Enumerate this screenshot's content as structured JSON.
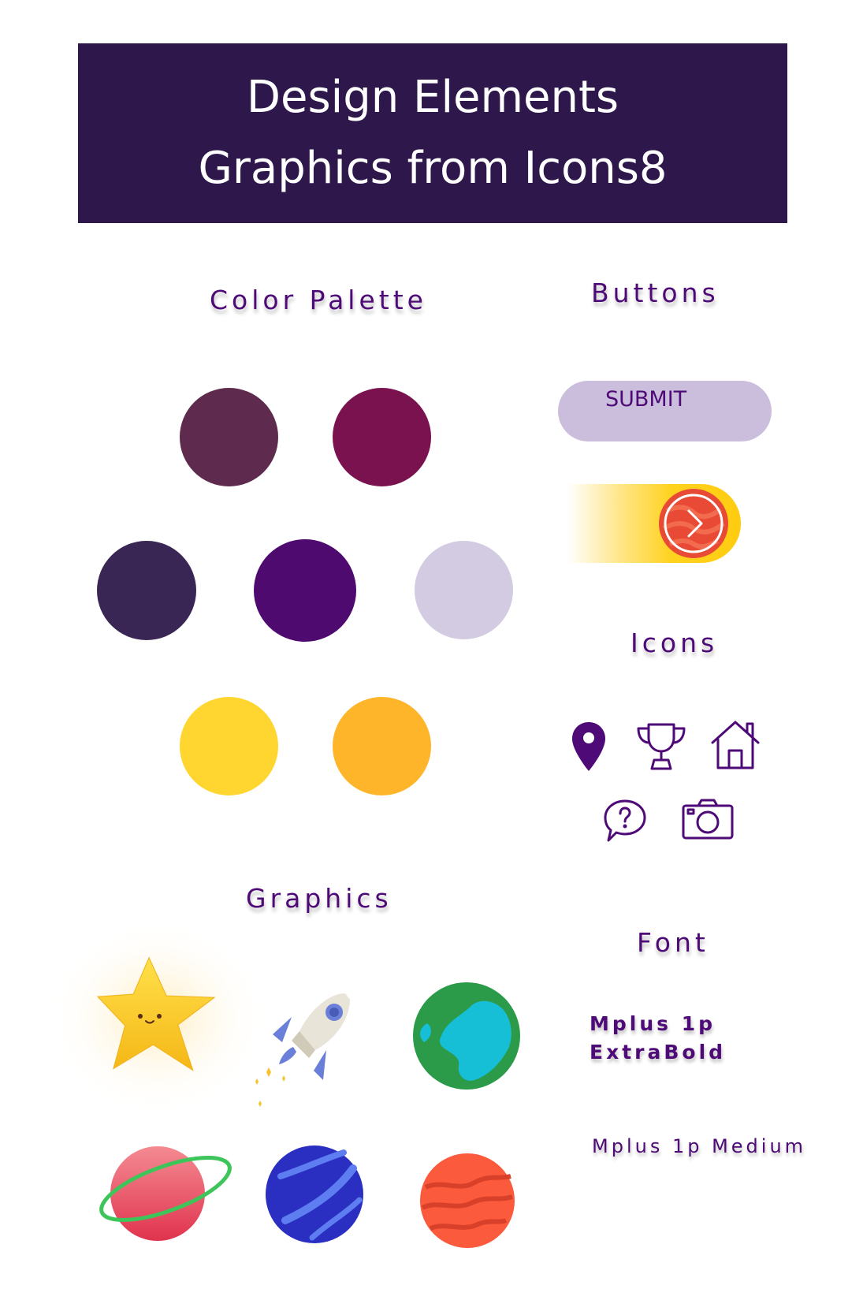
{
  "header": {
    "line1": "Design Elements",
    "line2": "Graphics from Icons8",
    "background": "#2d174b"
  },
  "sections": {
    "color_palette": "Color Palette",
    "buttons": "Buttons",
    "icons": "Icons",
    "graphics": "Graphics",
    "font": "Font"
  },
  "palette": [
    "#5e2a4e",
    "#7b1250",
    "#3a2654",
    "#4e0a6f",
    "#d2cbe2",
    "#ffd630",
    "#ffb52a"
  ],
  "buttons": {
    "submit_label": "SUBMIT",
    "submit_color": "#cbbddc",
    "slider_icon": "chevron-right-icon"
  },
  "icons": [
    "map-pin-icon",
    "trophy-icon",
    "home-icon",
    "help-speech-bubble-icon",
    "camera-icon"
  ],
  "graphics": [
    "star-graphic",
    "rocket-graphic",
    "earth-graphic",
    "ringed-planet-graphic",
    "blue-planet-graphic",
    "red-planet-graphic"
  ],
  "fonts": {
    "bold_sample": "Mplus 1p\nExtraBold",
    "medium_sample": "Mplus 1p Medium"
  },
  "accent": "#4e0a77"
}
